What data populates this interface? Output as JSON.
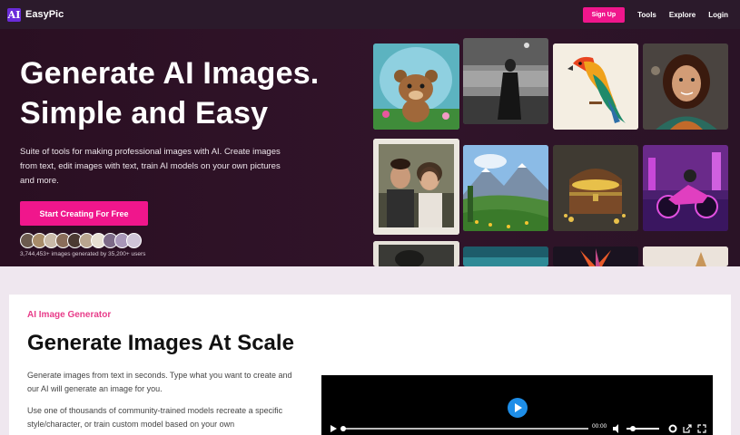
{
  "nav": {
    "logo_mark": "AI",
    "brand": "EasyPic",
    "signup": "Sign Up",
    "links": [
      "Tools",
      "Explore",
      "Login"
    ]
  },
  "hero": {
    "title_line1": "Generate AI Images.",
    "title_line2": "Simple and Easy",
    "description": "Suite of tools for making professional images with AI. Create images from text, edit images with text, train AI models on your own pictures and more.",
    "cta": "Start Creating For Free",
    "stats": "3,744,453+ images generated by 35,200+ users"
  },
  "section": {
    "eyebrow": "AI Image Generator",
    "title": "Generate Images At Scale",
    "p1": "Generate images from text in seconds. Type what you want to create and our AI will generate an image for you.",
    "p2": "Use one of thousands of community-trained models recreate a specific style/character, or train custom model based on your own"
  },
  "video": {
    "time": "00:00"
  },
  "colors": {
    "accent": "#f0168c",
    "eyebrow": "#e83d8a",
    "play": "#1e8ee8",
    "hero_bg": "#2a0f22"
  }
}
